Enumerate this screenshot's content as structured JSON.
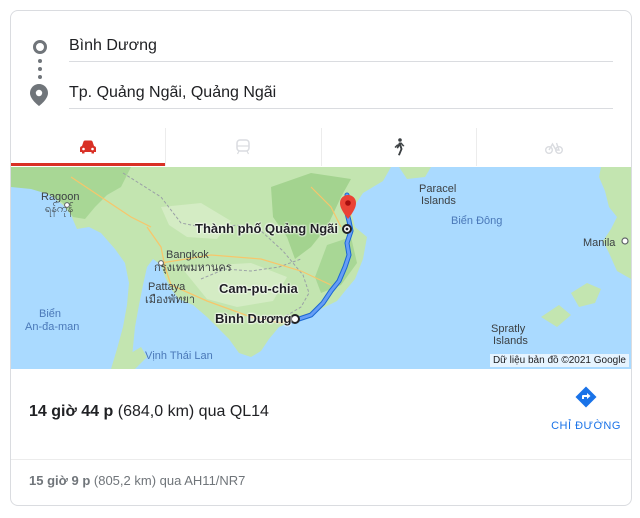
{
  "origin": {
    "value": "Bình Dương"
  },
  "destination": {
    "value": "Tp. Quảng Ngãi, Quảng Ngãi"
  },
  "tabs": [
    {
      "icon": "car-icon",
      "active": true
    },
    {
      "icon": "transit-icon",
      "active": false
    },
    {
      "icon": "walk-icon",
      "active": false
    },
    {
      "icon": "bicycle-icon",
      "active": false
    }
  ],
  "map": {
    "labels": {
      "raqoon": "Ragoon",
      "raqoon_script": "ရန်ကုန်",
      "bangkok": "Bangkok",
      "bangkok_thai": "กรุงเทพมหานคร",
      "pattaya": "Pattaya",
      "pattaya_thai": "เมืองพัทยา",
      "andaman_1": "Biển",
      "andaman_2": "An-đa-man",
      "gulf": "Vịnh Thái Lan",
      "cambodia": "Cam-pu-chia",
      "quang_ngai": "Thành phố Quảng Ngãi",
      "binh_duong": "Bình Dương",
      "paracel_1": "Paracel",
      "paracel_2": "Islands",
      "bien_dong": "Biển Đông",
      "manila": "Manila",
      "spratly_1": "Spratly",
      "spratly_2": "Islands"
    },
    "attribution": "Dữ liệu bản đồ ©2021 Google",
    "colors": {
      "water": "#aadaff",
      "land": "#c3e5b0",
      "route": "#4285f4",
      "pin": "#ea4335"
    }
  },
  "route": {
    "duration": "14 giờ 44 p",
    "distance": "(684,0 km)",
    "via": "qua QL14"
  },
  "directions": {
    "label": "CHỈ ĐƯỜNG",
    "icon": "directions-icon"
  },
  "alternative": {
    "duration": "15 giờ 9 p",
    "distance": "(805,2 km)",
    "via": "qua AH11/NR7"
  }
}
